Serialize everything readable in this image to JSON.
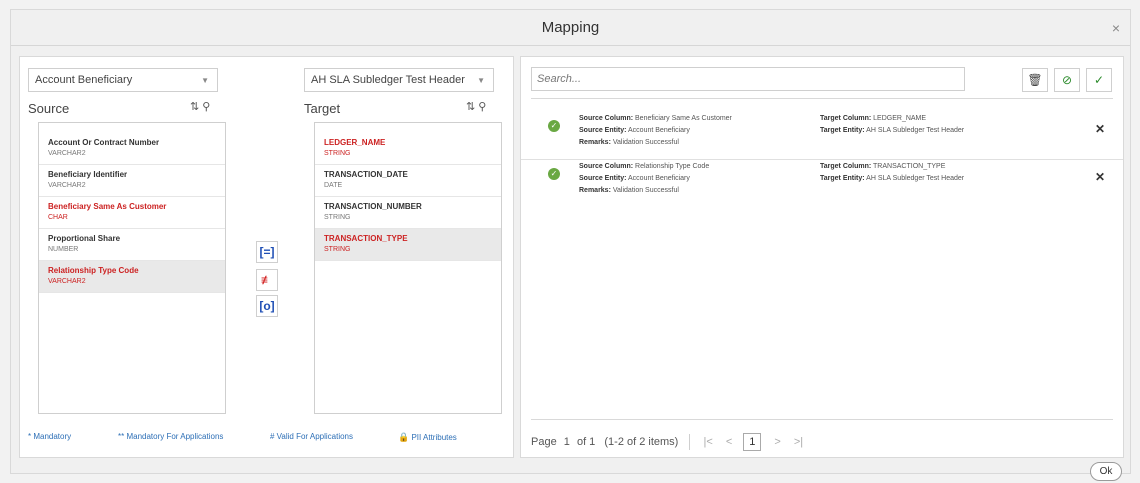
{
  "dialog": {
    "title": "Mapping",
    "close": "×",
    "ok_label": "Ok"
  },
  "source": {
    "entity": "Account Beneficiary",
    "title": "Source",
    "items": [
      {
        "name": "Account Or Contract Number",
        "type": "VARCHAR2",
        "required": false
      },
      {
        "name": "Beneficiary Identifier",
        "type": "VARCHAR2",
        "required": false
      },
      {
        "name": "Beneficiary Same As Customer",
        "type": "CHAR",
        "required": true
      },
      {
        "name": "Proportional Share",
        "type": "NUMBER",
        "required": false
      },
      {
        "name": "Relationship Type Code",
        "type": "VARCHAR2",
        "required": true
      }
    ]
  },
  "target": {
    "entity": "AH SLA Subledger Test Header",
    "title": "Target",
    "items": [
      {
        "name": "LEDGER_NAME",
        "type": "STRING",
        "required": true
      },
      {
        "name": "TRANSACTION_DATE",
        "type": "DATE",
        "required": false
      },
      {
        "name": "TRANSACTION_NUMBER",
        "type": "STRING",
        "required": false
      },
      {
        "name": "TRANSACTION_TYPE",
        "type": "STRING",
        "required": true
      }
    ]
  },
  "legend": {
    "mandatory": "* Mandatory",
    "mandatory_apps": "** Mandatory For Applications",
    "valid_apps": "# Valid For Applications",
    "pii": "PII Attributes"
  },
  "mappings": {
    "search_placeholder": "Search...",
    "rows": [
      {
        "source_column_label": "Source Column:",
        "source_column": "Beneficiary Same As Customer",
        "source_entity_label": "Source Entity:",
        "source_entity": "Account Beneficiary",
        "remarks_label": "Remarks:",
        "remarks": "Validation Successful",
        "target_column_label": "Target Column:",
        "target_column": "LEDGER_NAME",
        "target_entity_label": "Target Entity:",
        "target_entity": "AH SLA Subledger Test Header"
      },
      {
        "source_column_label": "Source Column:",
        "source_column": "Relationship Type Code",
        "source_entity_label": "Source Entity:",
        "source_entity": "Account Beneficiary",
        "remarks_label": "Remarks:",
        "remarks": "Validation Successful",
        "target_column_label": "Target Column:",
        "target_column": "TRANSACTION_TYPE",
        "target_entity_label": "Target Entity:",
        "target_entity": "AH SLA Subledger Test Header"
      }
    ]
  },
  "pager": {
    "page_label": "Page",
    "page": "1",
    "of_label": "of 1",
    "items": "(1-2 of 2 items)",
    "current": "1"
  },
  "colors": {
    "required": "#cc2222",
    "link": "#2d6fb6",
    "success": "#6aa843"
  }
}
